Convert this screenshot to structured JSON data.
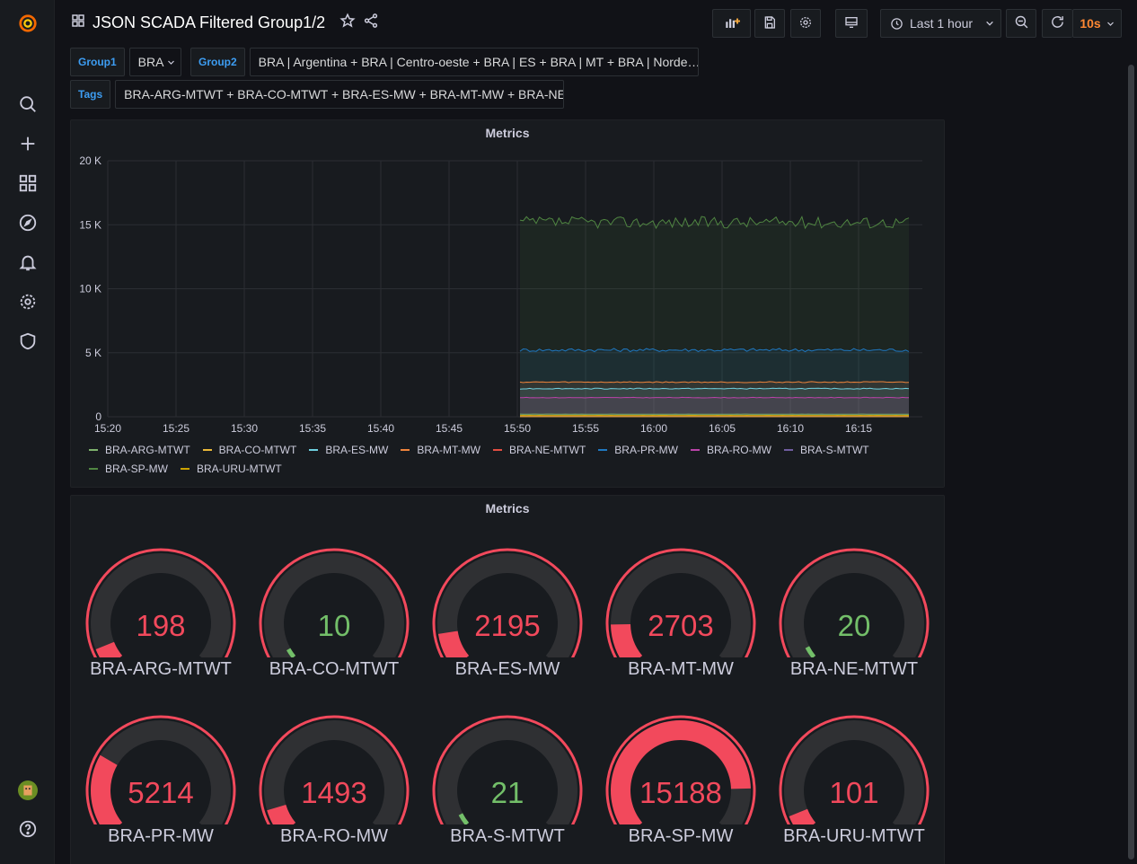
{
  "topbar": {
    "title": "JSON SCADA Filtered Group1/2",
    "time_range": "Last 1 hour",
    "refresh": "10s"
  },
  "variables": {
    "group1_label": "Group1",
    "group1_value": "BRA",
    "group2_label": "Group2",
    "group2_value": "BRA | Argentina + BRA | Centro-oeste + BRA | ES + BRA | MT + BRA | Norde…",
    "tags_label": "Tags",
    "tags_value": "BRA-ARG-MTWT + BRA-CO-MTWT + BRA-ES-MW + BRA-MT-MW + BRA-NE…"
  },
  "timeseries_panel": {
    "title": "Metrics"
  },
  "gauge_panel": {
    "title": "Metrics"
  },
  "chart_data": {
    "type": "area",
    "ylim": [
      0,
      20000
    ],
    "yticks": [
      "0",
      "5 K",
      "10 K",
      "15 K",
      "20 K"
    ],
    "xticks": [
      "15:20",
      "15:25",
      "15:30",
      "15:35",
      "15:40",
      "15:45",
      "15:50",
      "15:55",
      "16:00",
      "16:05",
      "16:10",
      "16:15"
    ],
    "x_start_label": "15:50",
    "x_end_label": "16:19",
    "series": [
      {
        "name": "BRA-ARG-MTWT",
        "color": "#7eb26d",
        "value": 198
      },
      {
        "name": "BRA-CO-MTWT",
        "color": "#eab839",
        "value": 10
      },
      {
        "name": "BRA-ES-MW",
        "color": "#6ed0e0",
        "value": 2195
      },
      {
        "name": "BRA-MT-MW",
        "color": "#ef843c",
        "value": 2703
      },
      {
        "name": "BRA-NE-MTWT",
        "color": "#e24d42",
        "value": 20
      },
      {
        "name": "BRA-PR-MW",
        "color": "#1f78c1",
        "value": 5214
      },
      {
        "name": "BRA-RO-MW",
        "color": "#ba43a9",
        "value": 1493
      },
      {
        "name": "BRA-S-MTWT",
        "color": "#705da0",
        "value": 21
      },
      {
        "name": "BRA-SP-MW",
        "color": "#508642",
        "value": 15188
      },
      {
        "name": "BRA-URU-MTWT",
        "color": "#cca300",
        "value": 101
      }
    ]
  },
  "gauges": [
    {
      "label": "BRA-ARG-MTWT",
      "value": "198",
      "fraction": 0.07,
      "color": "#f2495c"
    },
    {
      "label": "BRA-CO-MTWT",
      "value": "10",
      "fraction": 0.04,
      "color": "#73bf69"
    },
    {
      "label": "BRA-ES-MW",
      "value": "2195",
      "fraction": 0.12,
      "color": "#f2495c"
    },
    {
      "label": "BRA-MT-MW",
      "value": "2703",
      "fraction": 0.15,
      "color": "#f2495c"
    },
    {
      "label": "BRA-NE-MTWT",
      "value": "20",
      "fraction": 0.05,
      "color": "#73bf69"
    },
    {
      "label": "BRA-PR-MW",
      "value": "5214",
      "fraction": 0.27,
      "color": "#f2495c"
    },
    {
      "label": "BRA-RO-MW",
      "value": "1493",
      "fraction": 0.09,
      "color": "#f2495c"
    },
    {
      "label": "BRA-S-MTWT",
      "value": "21",
      "fraction": 0.05,
      "color": "#73bf69"
    },
    {
      "label": "BRA-SP-MW",
      "value": "15188",
      "fraction": 0.84,
      "color": "#f2495c"
    },
    {
      "label": "BRA-URU-MTWT",
      "value": "101",
      "fraction": 0.07,
      "color": "#f2495c"
    }
  ]
}
